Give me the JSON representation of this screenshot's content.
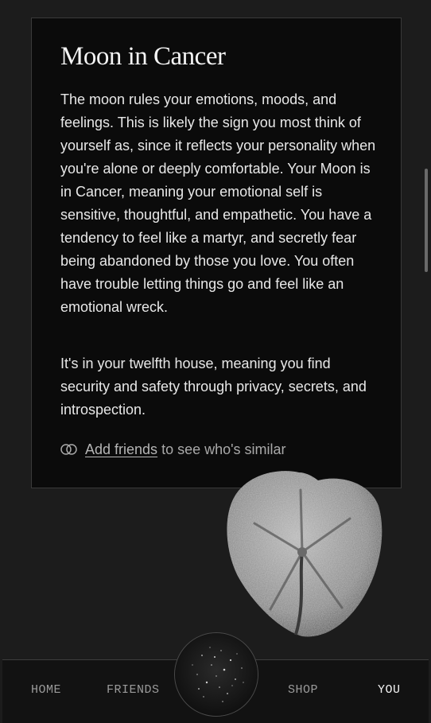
{
  "card": {
    "title": "Moon in Cancer",
    "paragraph1": "The moon rules your emotions, moods, and feelings. This is likely the sign you most think of yourself as, since it reflects your personality when you're alone or deeply comfortable. Your Moon is in Cancer, meaning your emotional self is sensitive, thoughtful, and empathetic. You have a tendency to feel like a martyr, and secretly fear being abandoned by those you love. You often have trouble letting things go and feel like an emotional wreck.",
    "paragraph2": "It's in your twelfth house, meaning you find security and safety through privacy, secrets, and introspection.",
    "friends_link": "Add friends",
    "friends_text": "to see who's similar",
    "friends_icon": "overlapping-circles-icon"
  },
  "nav": {
    "home": "HOME",
    "friends": "FRIENDS",
    "shop": "SHOP",
    "you": "YOU",
    "active": "YOU",
    "center_icon": "starfield-orb-icon"
  }
}
